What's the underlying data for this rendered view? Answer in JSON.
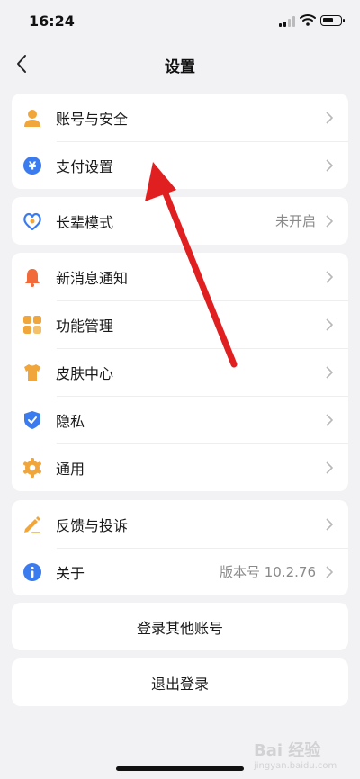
{
  "status_bar": {
    "time": "16:24"
  },
  "header": {
    "title": "设置"
  },
  "group1": {
    "account_security": "账号与安全",
    "payment_settings": "支付设置"
  },
  "group2": {
    "elder_mode": "长辈模式",
    "elder_mode_status": "未开启"
  },
  "group3": {
    "notifications": "新消息通知",
    "feature_management": "功能管理",
    "skin_center": "皮肤中心",
    "privacy": "隐私",
    "general": "通用"
  },
  "group4": {
    "feedback": "反馈与投诉",
    "about": "关于",
    "version": "版本号 10.2.76"
  },
  "actions": {
    "login_other": "登录其他账号",
    "logout": "退出登录"
  },
  "colors": {
    "background": "#f2f2f4",
    "card": "#ffffff",
    "orange": "#f0a63a",
    "blue": "#3b7bf0",
    "red_arrow": "#e02020"
  },
  "icons": {
    "account_security": "person-icon",
    "payment_settings": "yuan-icon",
    "elder_mode": "heart-icon",
    "notifications": "bell-icon",
    "feature_management": "grid-icon",
    "skin_center": "tshirt-icon",
    "privacy": "shield-icon",
    "general": "gear-icon",
    "feedback": "pencil-icon",
    "about": "info-icon"
  },
  "watermark": {
    "brand": "Bai 经验",
    "url": "jingyan.baidu.com"
  }
}
